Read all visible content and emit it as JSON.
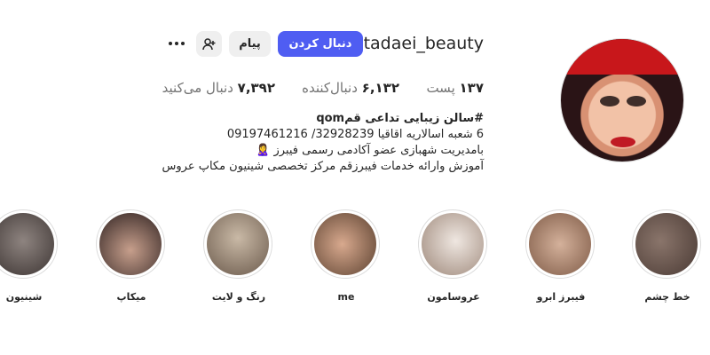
{
  "profile": {
    "username": "tadaei_beauty",
    "follow_label": "دنبال کردن",
    "message_label": "پیام",
    "suggest_icon": "person-plus-icon",
    "more_icon": "more-options-icon",
    "stats": {
      "posts_value": "۱۳۷",
      "posts_label": "پست",
      "followers_value": "۶,۱۳۲",
      "followers_label": "دنبال‌کننده",
      "following_value": "۷,۳۹۲",
      "following_label": "دنبال می‌کنید"
    },
    "bio": {
      "line1": "#سالن زیبایی تداعی قمqom",
      "line2": "6 شعبه اسالاریه اقاقیا 32928239/ 09197461216",
      "line3": "بامدیریت شهبازی عضو آکادمی رسمی فیبرز 🙎‍♀️",
      "line4": "آموزش وارائه خدمات فیبرزقم مرکز تخصصی شینیون مکاپ عروس"
    }
  },
  "highlights": [
    {
      "label": "خط چشم",
      "color": "#6e5a52"
    },
    {
      "label": "فیبرز ابرو",
      "color": "#a7836e"
    },
    {
      "label": "عروسامون",
      "color": "#c9b9ae"
    },
    {
      "label": "me",
      "color": "#7a5f4b"
    },
    {
      "label": "رنگ و لایت",
      "color": "#8c7b6c"
    },
    {
      "label": "میکاپ",
      "color": "#4a3734"
    },
    {
      "label": "شینیون",
      "color": "#5d5350"
    }
  ],
  "colors": {
    "follow_button": "#4f5df2",
    "secondary_button": "#efefef",
    "muted_text": "#737373"
  }
}
